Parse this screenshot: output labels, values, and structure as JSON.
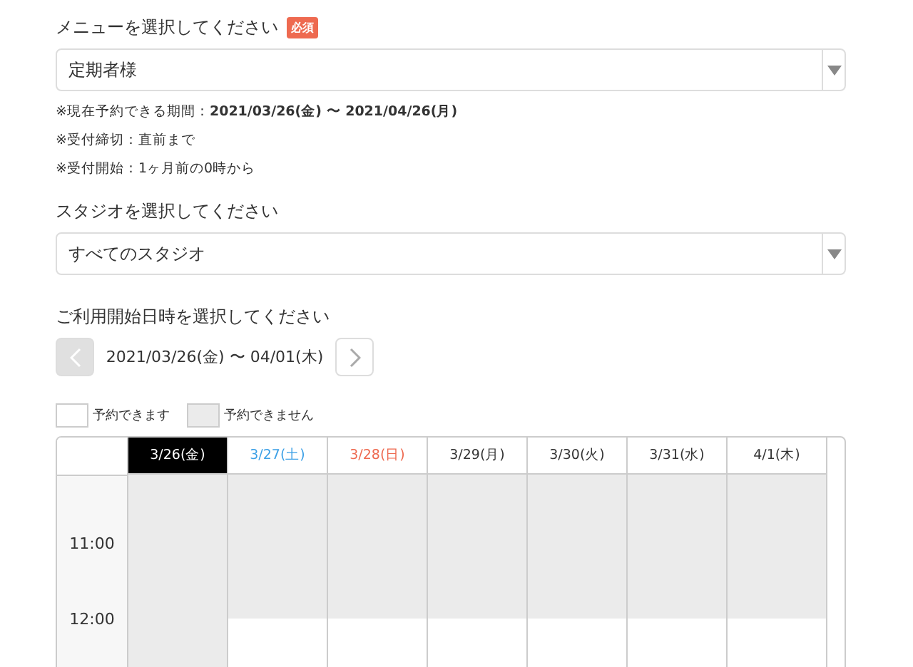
{
  "menu_field": {
    "label": "メニューを選択してください",
    "badge": "必須",
    "value": "定期者様"
  },
  "notes": [
    "※現在予約できる期間：**2021/03/26(金) 〜 2021/04/26(月)**",
    "※受付締切：直前まで",
    "※受付開始：1ヶ月前の0時から"
  ],
  "studio_field": {
    "label": "スタジオを選択してください",
    "value": "すべてのスタジオ"
  },
  "date_picker": {
    "label": "ご利用開始日時を選択してください",
    "prev_disabled": true,
    "next_disabled": false,
    "range": "2021/03/26(金) 〜 04/01(木)"
  },
  "legend": [
    {
      "kind": "available",
      "label": "予約できます"
    },
    {
      "kind": "unavailable",
      "label": "予約できません"
    }
  ],
  "calendar": {
    "times": [
      "11:00",
      "12:00"
    ],
    "days": [
      {
        "label": "3/26(金)",
        "selected": true,
        "kind": "weekday",
        "slots": [
          {
            "available": false
          },
          {
            "available": false
          }
        ]
      },
      {
        "label": "3/27(土)",
        "selected": false,
        "kind": "saturday",
        "slots": [
          {
            "available": false
          },
          {
            "available": true
          }
        ]
      },
      {
        "label": "3/28(日)",
        "selected": false,
        "kind": "sunday",
        "slots": [
          {
            "available": false
          },
          {
            "available": true
          }
        ]
      },
      {
        "label": "3/29(月)",
        "selected": false,
        "kind": "weekday",
        "slots": [
          {
            "available": false
          },
          {
            "available": true
          }
        ]
      },
      {
        "label": "3/30(火)",
        "selected": false,
        "kind": "weekday",
        "slots": [
          {
            "available": false
          },
          {
            "available": true
          }
        ]
      },
      {
        "label": "3/31(水)",
        "selected": false,
        "kind": "weekday",
        "slots": [
          {
            "available": false
          },
          {
            "available": true
          }
        ]
      },
      {
        "label": "4/1(木)",
        "selected": false,
        "kind": "weekday",
        "slots": [
          {
            "available": false
          },
          {
            "available": true
          }
        ]
      }
    ]
  }
}
